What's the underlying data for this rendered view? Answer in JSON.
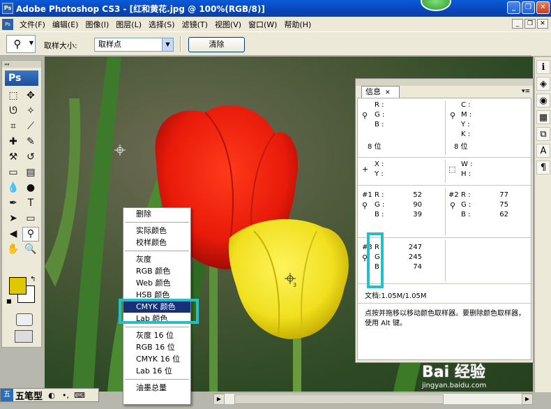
{
  "window": {
    "title": "Adobe Photoshop CS3 - [红和黄花.jpg @ 100%(RGB/8)]"
  },
  "menu": [
    "文件(F)",
    "编辑(E)",
    "图像(I)",
    "图层(L)",
    "选择(S)",
    "滤镜(T)",
    "视图(V)",
    "窗口(W)",
    "帮助(H)"
  ],
  "options": {
    "sample_size_label": "取样大小:",
    "sample_size_value": "取样点",
    "clear_label": "清除"
  },
  "toolbox": {
    "logo": "Ps"
  },
  "colors": {
    "foreground": "#e0c800",
    "background": "#ffffff",
    "annotation": "#22c0c8"
  },
  "info_panel": {
    "tab": "信息",
    "rgb": {
      "r": "R :",
      "g": "G :",
      "b": "B :",
      "bits": "8 位"
    },
    "cmyk": {
      "c": "C :",
      "m": "M :",
      "y": "Y :",
      "k": "K :",
      "bits": "8 位"
    },
    "xy": {
      "x": "X :",
      "y": "Y :"
    },
    "wh": {
      "w": "W :",
      "h": "H :"
    },
    "sampler1": {
      "id": "#1",
      "r": "52",
      "g": "90",
      "b": "39"
    },
    "sampler2": {
      "id": "#2",
      "r": "77",
      "g": "75",
      "b": "62"
    },
    "sampler3": {
      "id": "#3",
      "r": "247",
      "g": "245",
      "b": "74"
    },
    "doc": "文档:1.05M/1.05M",
    "hint": "点按并拖移以移动颜色取样器。要删除颜色取样器，使用 Alt 键。"
  },
  "context_menu": {
    "items": [
      "删除",
      "实际颜色",
      "校样颜色",
      "灰度",
      "RGB 颜色",
      "Web 颜色",
      "HSB 颜色",
      "CMYK 颜色",
      "Lab 颜色",
      "灰度 16 位",
      "RGB 16 位",
      "CMYK 16 位",
      "Lab 16 位",
      "油墨总量"
    ],
    "highlighted": "CMYK 颜色"
  },
  "ime": {
    "name": "五笔型"
  },
  "watermark": {
    "brand": "Bai 经验",
    "url": "jingyan.baidu.com"
  }
}
